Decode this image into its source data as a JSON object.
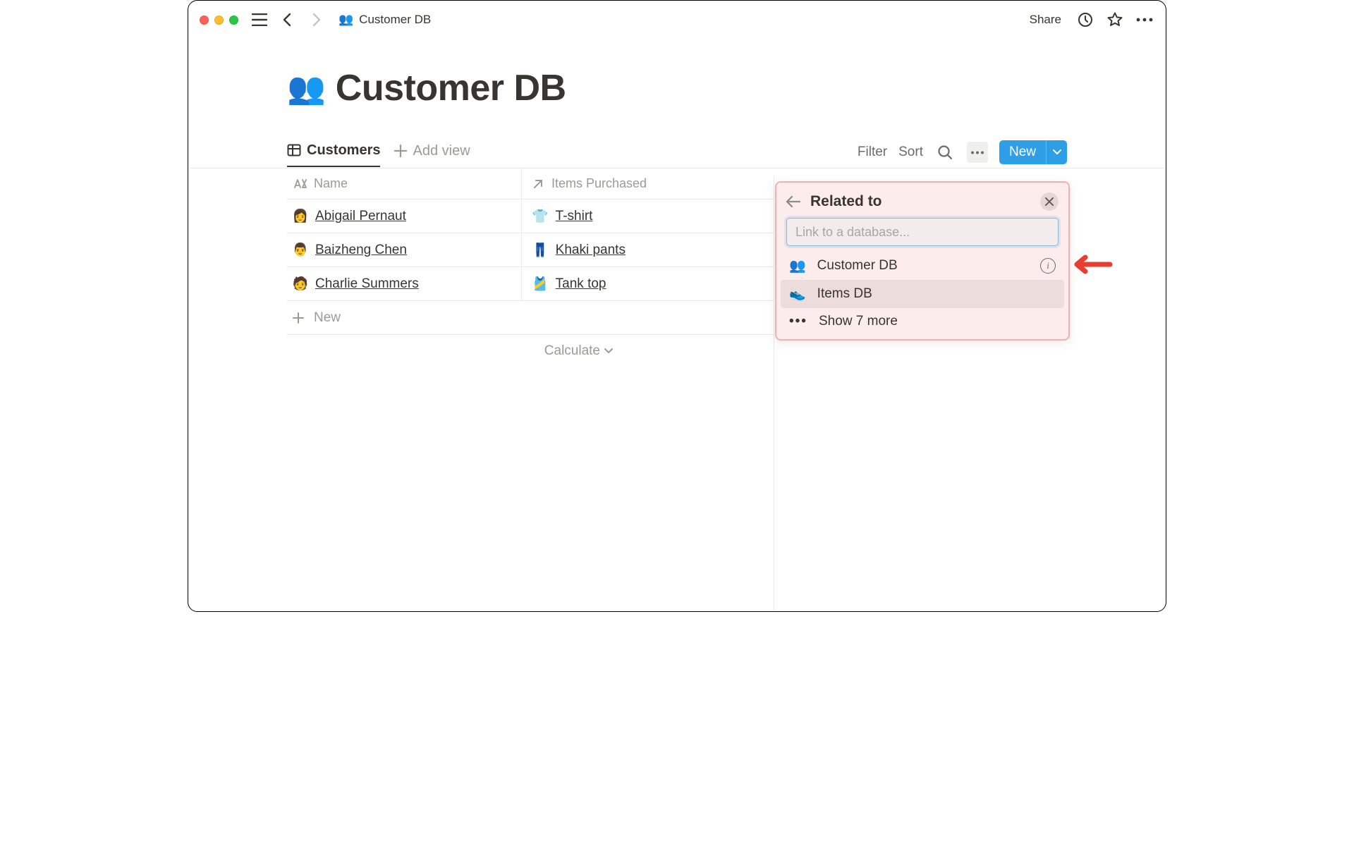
{
  "breadcrumb": {
    "icon": "👥",
    "title": "Customer DB"
  },
  "topbar": {
    "share": "Share"
  },
  "page": {
    "icon": "👥",
    "title": "Customer DB"
  },
  "db": {
    "view_tab": "Customers",
    "add_view": "Add view",
    "filter": "Filter",
    "sort": "Sort",
    "new": "New"
  },
  "columns": {
    "name": "Name",
    "items": "Items Purchased"
  },
  "rows": [
    {
      "avatar": "👩",
      "name": "Abigail Pernaut",
      "item_icon": "👕",
      "item": "T-shirt"
    },
    {
      "avatar": "👨",
      "name": "Baizheng Chen",
      "item_icon": "👖",
      "item": "Khaki pants"
    },
    {
      "avatar": "🧑",
      "name": "Charlie Summers",
      "item_icon": "🎽",
      "item": "Tank top"
    }
  ],
  "new_row": "New",
  "calculate": "Calculate",
  "popover": {
    "title": "Related to",
    "placeholder": "Link to a database...",
    "options": [
      {
        "icon": "👥",
        "label": "Customer DB",
        "info": true
      },
      {
        "icon": "👟",
        "label": "Items DB",
        "selected": true
      },
      {
        "icon": "•••",
        "label": "Show 7 more",
        "dots": true
      }
    ]
  }
}
